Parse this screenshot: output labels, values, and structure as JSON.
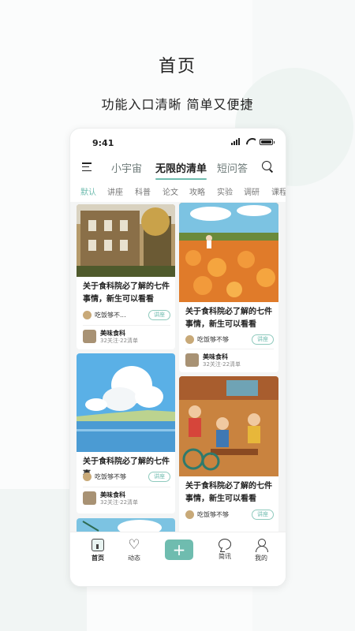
{
  "headline": "首页",
  "subhead": "功能入口清晰 简单又便捷",
  "status": {
    "time": "9:41"
  },
  "topnav": {
    "tabs": [
      "小宇宙",
      "无限的清单",
      "短问答"
    ],
    "active_tab": 1
  },
  "categories": [
    "默认",
    "讲座",
    "科普",
    "论文",
    "攻略",
    "实验",
    "调研",
    "课程"
  ],
  "cards": [
    {
      "title": "关于食科院必了解的七件事情，新生可以看看",
      "author": "吃饭够不...",
      "tag": "讲座",
      "source": "美味食科",
      "meta": "32关注·22清单"
    },
    {
      "title": "关于食科院必了解的七件事情，新生可以看看",
      "author": "吃饭够不够",
      "tag": "讲座",
      "source": "美味食科",
      "meta": "32关注·22清单"
    },
    {
      "title": "关于食科院必了解的七件事",
      "author": "吃饭够不够",
      "tag": "讲座",
      "source": "美味食科",
      "meta": "32关注·22清单"
    },
    {
      "title": "关于食科院必了解的七件事情，新生可以看看",
      "author": "吃饭够不够",
      "tag": "讲座"
    }
  ],
  "bottom_nav": {
    "home": "首页",
    "feed": "动态",
    "add": "+",
    "news": "简讯",
    "me": "我的"
  },
  "colors": {
    "accent": "#6fbcaf"
  }
}
